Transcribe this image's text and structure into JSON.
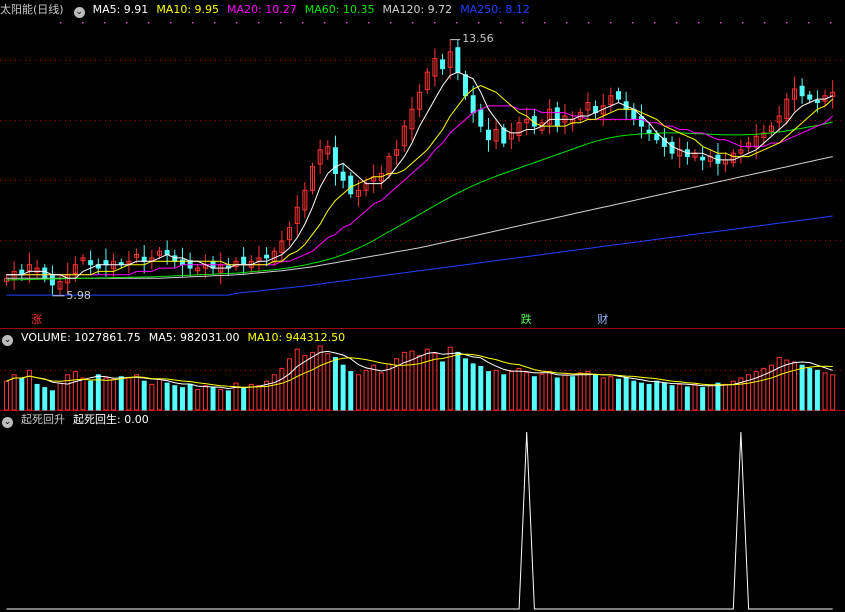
{
  "colors": {
    "up": "#ff3232",
    "down": "#54fcfc",
    "ma5": "#ffffff",
    "ma10": "#ffff00",
    "ma20": "#ff00ff",
    "ma60": "#00e600",
    "ma120": "#d0d0d0",
    "ma250": "#2040ff",
    "grid": "#a00000",
    "text": "#c8c8c8"
  },
  "price_panel": {
    "stock_name": "太阳能",
    "period": "(日线)",
    "legend": [
      {
        "label": "MA5: 9.91",
        "color": "#ffffff"
      },
      {
        "label": "MA10: 9.95",
        "color": "#ffff00"
      },
      {
        "label": "MA20: 10.27",
        "color": "#ff00ff"
      },
      {
        "label": "MA60: 10.35",
        "color": "#00e600"
      },
      {
        "label": "MA120: 9.72",
        "color": "#d0d0d0"
      },
      {
        "label": "MA250: 8.12",
        "color": "#2040ff"
      }
    ],
    "high_label": "13.56",
    "low_label": "5.98",
    "markers": [
      {
        "text": "涨",
        "color": "#ff3232",
        "index": 4
      },
      {
        "text": "跌",
        "color": "#54fc54",
        "index": 68
      },
      {
        "text": "财",
        "color": "#8fb8ff",
        "index": 78
      }
    ]
  },
  "volume_panel": {
    "legend": [
      {
        "label": "VOLUME: 1027861.75",
        "color": "#ffffff"
      },
      {
        "label": "MA5: 982031.00",
        "color": "#ffffff"
      },
      {
        "label": "MA10: 944312.50",
        "color": "#ffff00"
      }
    ]
  },
  "indicator_panel": {
    "name": "起死回升",
    "legend": [
      {
        "label": "起死回生: 0.00",
        "color": "#ffffff"
      }
    ]
  },
  "chart_data": {
    "type": "candlestick",
    "closes": [
      6.5,
      6.7,
      6.6,
      6.9,
      6.8,
      6.5,
      6.3,
      6.4,
      6.6,
      6.9,
      7.1,
      6.9,
      6.8,
      6.9,
      7.0,
      6.9,
      7.0,
      7.2,
      7.0,
      7.1,
      7.3,
      7.2,
      7.0,
      6.9,
      6.8,
      6.8,
      6.9,
      6.8,
      6.9,
      6.8,
      7.0,
      6.9,
      7.0,
      7.1,
      7.1,
      7.3,
      7.6,
      8.0,
      8.6,
      9.1,
      9.8,
      10.3,
      10.4,
      9.6,
      9.4,
      9.0,
      9.1,
      9.3,
      9.5,
      9.6,
      10.1,
      10.3,
      11.0,
      11.5,
      12.0,
      12.6,
      13.0,
      12.7,
      13.2,
      12.6,
      11.9,
      11.4,
      11.0,
      10.6,
      10.9,
      10.5,
      10.8,
      11.1,
      11.2,
      11.0,
      11.1,
      11.5,
      11.0,
      11.3,
      11.2,
      11.4,
      11.7,
      11.4,
      11.6,
      11.9,
      11.8,
      11.5,
      11.2,
      11.0,
      10.8,
      10.6,
      10.4,
      10.2,
      10.3,
      10.1,
      10.2,
      10.0,
      10.1,
      9.9,
      10.0,
      10.2,
      10.3,
      10.5,
      10.7,
      10.8,
      11.0,
      11.3,
      11.8,
      12.1,
      11.9,
      11.8,
      11.7,
      11.9,
      12.0
    ],
    "ma5": [
      6.6,
      6.6,
      6.6,
      6.7,
      6.7,
      6.7,
      6.6,
      6.6,
      6.5,
      6.5,
      6.7,
      6.8,
      6.9,
      6.9,
      6.9,
      6.9,
      6.9,
      7.0,
      7.0,
      7.0,
      7.1,
      7.2,
      7.1,
      7.1,
      7.0,
      7.0,
      6.9,
      6.8,
      6.8,
      6.8,
      6.9,
      6.9,
      6.9,
      7.0,
      7.0,
      7.1,
      7.2,
      7.4,
      7.7,
      8.1,
      8.6,
      9.2,
      9.6,
      9.8,
      9.9,
      9.7,
      9.5,
      9.3,
      9.3,
      9.3,
      9.5,
      9.8,
      10.1,
      10.5,
      11.0,
      11.4,
      11.8,
      12.2,
      12.5,
      12.6,
      12.5,
      12.4,
      12.0,
      11.5,
      11.2,
      10.9,
      10.8,
      10.8,
      10.9,
      10.9,
      11.0,
      11.2,
      11.2,
      11.2,
      11.2,
      11.3,
      11.3,
      11.4,
      11.5,
      11.6,
      11.7,
      11.6,
      11.5,
      11.3,
      11.1,
      10.8,
      10.6,
      10.4,
      10.3,
      10.2,
      10.2,
      10.2,
      10.1,
      10.0,
      10.0,
      10.0,
      10.1,
      10.2,
      10.3,
      10.5,
      10.7,
      10.9,
      11.1,
      11.4,
      11.6,
      11.7,
      11.8,
      11.8,
      11.9
    ],
    "ma10": [
      6.6,
      6.6,
      6.6,
      6.6,
      6.6,
      6.6,
      6.6,
      6.6,
      6.6,
      6.6,
      6.6,
      6.6,
      6.7,
      6.7,
      6.7,
      6.8,
      6.9,
      6.9,
      6.9,
      7.0,
      7.0,
      7.0,
      7.0,
      7.0,
      7.0,
      7.0,
      7.0,
      7.0,
      7.0,
      6.9,
      6.9,
      6.9,
      6.9,
      6.9,
      6.9,
      7.0,
      7.0,
      7.2,
      7.3,
      7.5,
      7.8,
      8.1,
      8.5,
      8.8,
      9.0,
      9.2,
      9.3,
      9.4,
      9.5,
      9.5,
      9.6,
      9.6,
      9.7,
      9.9,
      10.1,
      10.3,
      10.6,
      10.9,
      11.3,
      11.6,
      11.9,
      12.1,
      12.2,
      12.1,
      12.0,
      11.8,
      11.6,
      11.4,
      11.3,
      11.1,
      11.0,
      11.0,
      11.0,
      11.0,
      11.1,
      11.1,
      11.2,
      11.2,
      11.3,
      11.4,
      11.5,
      11.5,
      11.5,
      11.4,
      11.3,
      11.2,
      11.0,
      10.9,
      10.8,
      10.7,
      10.6,
      10.4,
      10.3,
      10.2,
      10.2,
      10.1,
      10.1,
      10.1,
      10.2,
      10.3,
      10.4,
      10.5,
      10.7,
      10.9,
      11.1,
      11.3,
      11.5,
      11.6,
      11.8
    ],
    "ma20": [
      6.6,
      6.6,
      6.6,
      6.6,
      6.6,
      6.6,
      6.6,
      6.6,
      6.6,
      6.6,
      6.6,
      6.6,
      6.6,
      6.6,
      6.6,
      6.6,
      6.6,
      6.7,
      6.7,
      6.7,
      6.8,
      6.8,
      6.8,
      6.9,
      6.9,
      6.9,
      6.9,
      6.9,
      6.9,
      6.9,
      6.9,
      6.9,
      6.9,
      6.9,
      6.9,
      6.9,
      7.0,
      7.0,
      7.1,
      7.2,
      7.3,
      7.5,
      7.7,
      7.8,
      8.0,
      8.1,
      8.3,
      8.5,
      8.7,
      8.8,
      9.0,
      9.2,
      9.4,
      9.6,
      9.8,
      10.0,
      10.3,
      10.5,
      10.8,
      11.0,
      11.2,
      11.4,
      11.5,
      11.6,
      11.6,
      11.6,
      11.6,
      11.5,
      11.5,
      11.5,
      11.4,
      11.4,
      11.4,
      11.4,
      11.3,
      11.3,
      11.2,
      11.2,
      11.2,
      11.2,
      11.2,
      11.2,
      11.2,
      11.2,
      11.1,
      11.1,
      11.0,
      11.0,
      10.9,
      10.9,
      10.8,
      10.8,
      10.7,
      10.6,
      10.6,
      10.5,
      10.4,
      10.4,
      10.4,
      10.4,
      10.5,
      10.5,
      10.6,
      10.7,
      10.8,
      10.9,
      11.0,
      11.1,
      11.3
    ],
    "ma60": [
      6.45,
      6.45,
      6.46,
      6.46,
      6.47,
      6.47,
      6.48,
      6.48,
      6.49,
      6.49,
      6.5,
      6.5,
      6.51,
      6.51,
      6.52,
      6.52,
      6.53,
      6.53,
      6.54,
      6.54,
      6.55,
      6.56,
      6.57,
      6.58,
      6.59,
      6.6,
      6.61,
      6.62,
      6.63,
      6.64,
      6.65,
      6.67,
      6.69,
      6.71,
      6.73,
      6.75,
      6.78,
      6.81,
      6.85,
      6.89,
      6.94,
      6.99,
      7.05,
      7.12,
      7.2,
      7.29,
      7.39,
      7.5,
      7.62,
      7.75,
      7.88,
      8.0,
      8.13,
      8.26,
      8.39,
      8.52,
      8.65,
      8.78,
      8.9,
      9.02,
      9.13,
      9.24,
      9.34,
      9.43,
      9.52,
      9.6,
      9.68,
      9.76,
      9.84,
      9.92,
      10.0,
      10.08,
      10.16,
      10.24,
      10.32,
      10.4,
      10.48,
      10.55,
      10.61,
      10.66,
      10.7,
      10.73,
      10.75,
      10.77,
      10.78,
      10.79,
      10.8,
      10.8,
      10.8,
      10.79,
      10.78,
      10.77,
      10.76,
      10.75,
      10.74,
      10.74,
      10.74,
      10.75,
      10.76,
      10.78,
      10.8,
      10.83,
      10.86,
      10.9,
      10.94,
      10.98,
      11.02,
      11.07,
      11.12
    ],
    "ma120": [
      6.5,
      6.5,
      6.5,
      6.5,
      6.5,
      6.5,
      6.5,
      6.5,
      6.5,
      6.5,
      6.5,
      6.5,
      6.5,
      6.5,
      6.5,
      6.5,
      6.5,
      6.5,
      6.5,
      6.5,
      6.5,
      6.51,
      6.52,
      6.53,
      6.54,
      6.55,
      6.56,
      6.57,
      6.58,
      6.59,
      6.6,
      6.62,
      6.64,
      6.66,
      6.68,
      6.7,
      6.72,
      6.75,
      6.78,
      6.81,
      6.84,
      6.88,
      6.92,
      6.96,
      7.0,
      7.04,
      7.08,
      7.12,
      7.16,
      7.2,
      7.24,
      7.28,
      7.32,
      7.36,
      7.4,
      7.45,
      7.5,
      7.55,
      7.6,
      7.65,
      7.7,
      7.75,
      7.8,
      7.85,
      7.9,
      7.95,
      8.0,
      8.05,
      8.1,
      8.15,
      8.2,
      8.25,
      8.3,
      8.35,
      8.4,
      8.45,
      8.5,
      8.55,
      8.6,
      8.65,
      8.7,
      8.75,
      8.8,
      8.85,
      8.9,
      8.95,
      9.0,
      9.05,
      9.1,
      9.15,
      9.2,
      9.25,
      9.3,
      9.35,
      9.4,
      9.45,
      9.5,
      9.55,
      9.6,
      9.65,
      9.7,
      9.75,
      9.8,
      9.85,
      9.9,
      9.95,
      10.0,
      10.05,
      10.1
    ],
    "ma250": [
      6.0,
      6.0,
      6.0,
      6.0,
      6.0,
      6.0,
      6.0,
      6.0,
      6.0,
      6.0,
      6.0,
      6.0,
      6.0,
      6.0,
      6.0,
      6.0,
      6.0,
      6.0,
      6.0,
      6.0,
      6.0,
      6.0,
      6.0,
      6.0,
      6.0,
      6.0,
      6.0,
      6.0,
      6.0,
      6.0,
      6.05,
      6.08,
      6.1,
      6.12,
      6.15,
      6.17,
      6.2,
      6.22,
      6.25,
      6.27,
      6.3,
      6.33,
      6.36,
      6.39,
      6.42,
      6.45,
      6.48,
      6.51,
      6.54,
      6.57,
      6.6,
      6.63,
      6.66,
      6.69,
      6.72,
      6.75,
      6.78,
      6.81,
      6.84,
      6.87,
      6.9,
      6.93,
      6.96,
      6.99,
      7.02,
      7.05,
      7.08,
      7.11,
      7.14,
      7.17,
      7.2,
      7.23,
      7.26,
      7.29,
      7.32,
      7.35,
      7.38,
      7.41,
      7.44,
      7.47,
      7.5,
      7.53,
      7.56,
      7.59,
      7.62,
      7.65,
      7.68,
      7.71,
      7.74,
      7.77,
      7.8,
      7.83,
      7.86,
      7.89,
      7.92,
      7.95,
      7.98,
      8.01,
      8.04,
      8.07,
      8.1,
      8.13,
      8.16,
      8.19,
      8.22,
      8.25,
      8.28,
      8.31,
      8.34
    ],
    "volume_ratio": [
      0.45,
      0.55,
      0.5,
      0.62,
      0.4,
      0.35,
      0.3,
      0.42,
      0.55,
      0.6,
      0.5,
      0.45,
      0.55,
      0.5,
      0.48,
      0.52,
      0.5,
      0.55,
      0.45,
      0.4,
      0.48,
      0.42,
      0.38,
      0.35,
      0.4,
      0.32,
      0.38,
      0.35,
      0.32,
      0.3,
      0.42,
      0.35,
      0.4,
      0.38,
      0.45,
      0.55,
      0.65,
      0.8,
      0.95,
      0.85,
      0.9,
      1.0,
      0.88,
      0.82,
      0.7,
      0.6,
      0.55,
      0.62,
      0.7,
      0.58,
      0.72,
      0.8,
      0.9,
      0.92,
      0.85,
      0.95,
      0.88,
      0.75,
      0.98,
      0.9,
      0.8,
      0.72,
      0.68,
      0.6,
      0.62,
      0.55,
      0.6,
      0.65,
      0.58,
      0.52,
      0.56,
      0.6,
      0.5,
      0.55,
      0.52,
      0.58,
      0.6,
      0.55,
      0.5,
      0.52,
      0.48,
      0.5,
      0.45,
      0.42,
      0.4,
      0.45,
      0.42,
      0.38,
      0.4,
      0.36,
      0.4,
      0.35,
      0.38,
      0.42,
      0.4,
      0.45,
      0.5,
      0.55,
      0.6,
      0.65,
      0.7,
      0.82,
      0.78,
      0.75,
      0.7,
      0.65,
      0.62,
      0.58,
      0.55
    ],
    "signal_spikes": [
      68,
      96
    ],
    "ylim": [
      5.5,
      14.2
    ]
  }
}
